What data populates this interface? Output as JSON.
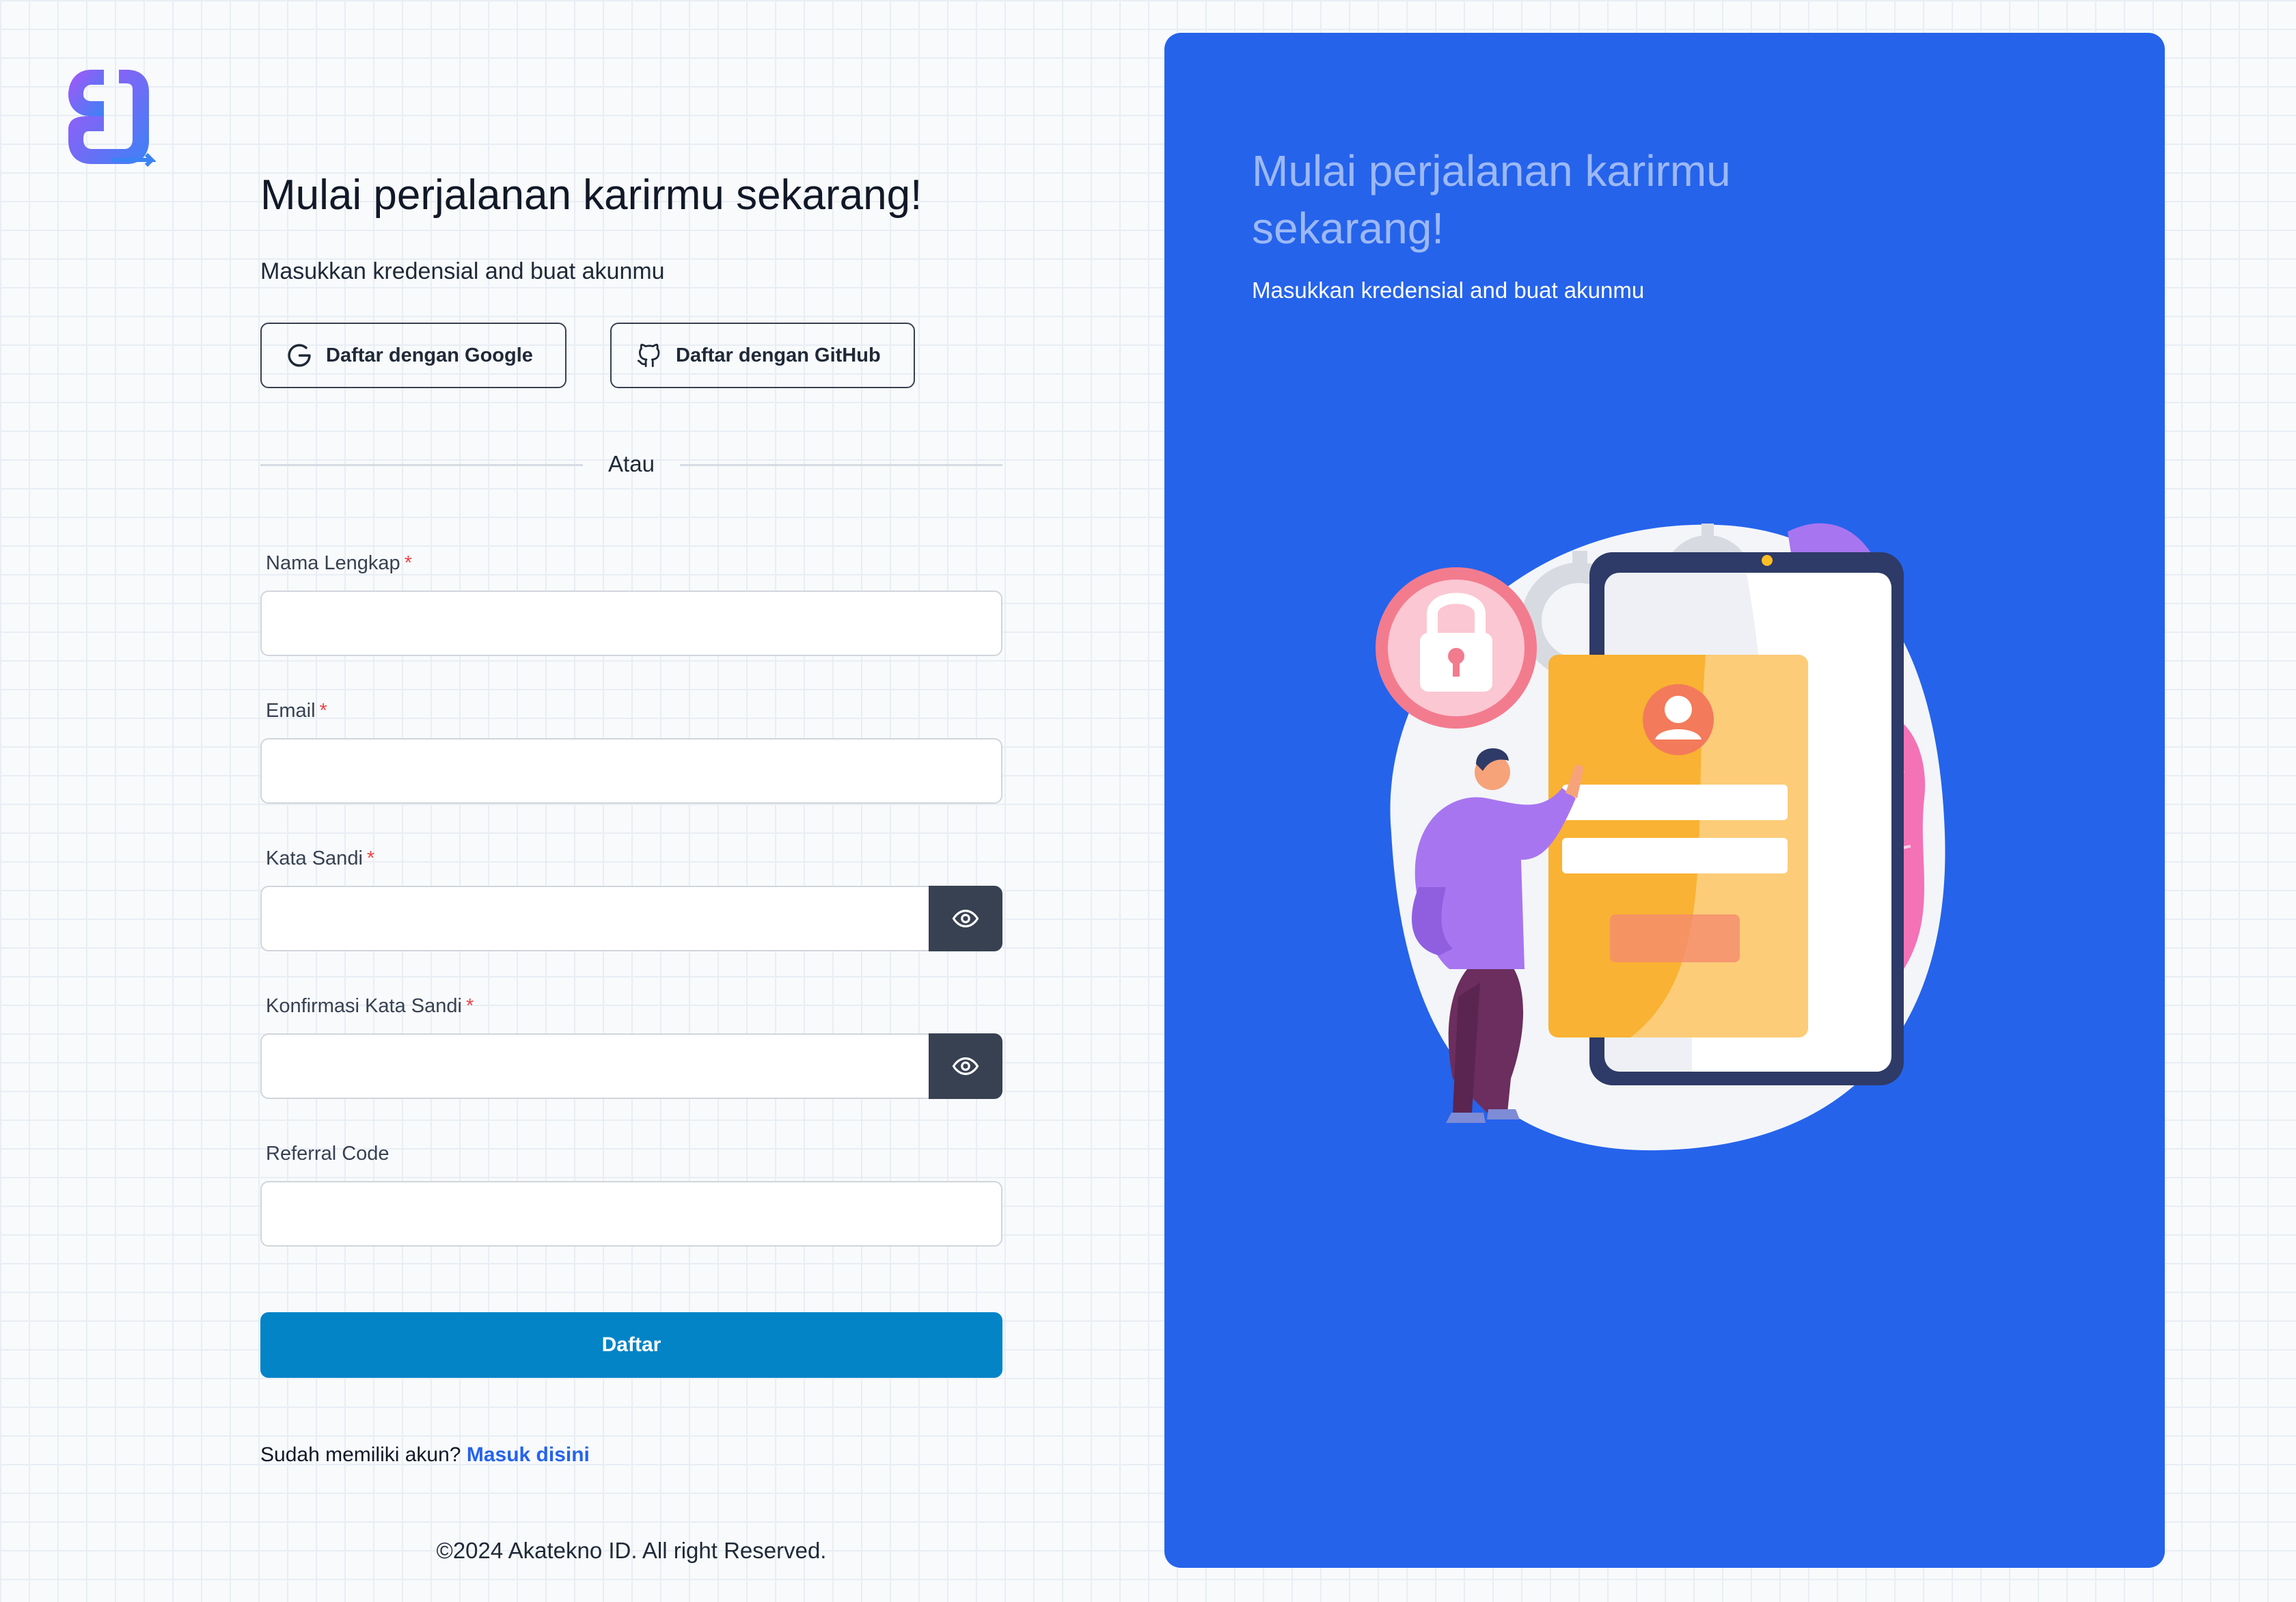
{
  "brand": {
    "logo_icon": "brand-logo-icon",
    "gradient": [
      "#a855f7",
      "#3b82f6"
    ]
  },
  "form": {
    "title": "Mulai perjalanan karirmu sekarang!",
    "subtitle": "Masukkan kredensial and buat akunmu",
    "google_button": "Daftar dengan Google",
    "github_button": "Daftar dengan GitHub",
    "divider_text": "Atau",
    "fields": {
      "full_name": {
        "label": "Nama Lengkap",
        "required_mark": "*",
        "value": ""
      },
      "email": {
        "label": "Email",
        "required_mark": "*",
        "value": ""
      },
      "password": {
        "label": "Kata Sandi",
        "required_mark": "*",
        "value": "",
        "toggle_icon": "eye-icon"
      },
      "confirm_password": {
        "label": "Konfirmasi Kata Sandi",
        "required_mark": "*",
        "value": "",
        "toggle_icon": "eye-icon"
      },
      "referral": {
        "label": "Referral Code",
        "value": ""
      }
    },
    "submit_label": "Daftar",
    "login_prompt": "Sudah memiliki akun?",
    "login_link": "Masuk disini",
    "footer": "©2024 Akatekno ID. All right Reserved."
  },
  "panel": {
    "title": "Mulai perjalanan karirmu sekarang!",
    "subtitle": "Masukkan kredensial and buat akunmu",
    "background_color": "#2563eb",
    "illustration": "signup-illustration"
  },
  "colors": {
    "primary_button": "#0284c7",
    "link": "#2563eb",
    "required": "#ef4444",
    "eye_button": "#374151"
  }
}
